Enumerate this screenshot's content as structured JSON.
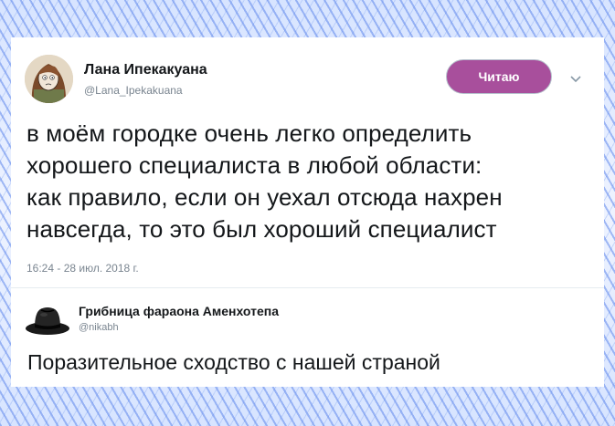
{
  "tweet": {
    "author_name": "Лана Ипекакуана",
    "author_handle": "@Lana_Ipekakuana",
    "follow_label": "Читаю",
    "text_lines": [
      "в моём городке очень легко определить",
      "хорошего специалиста в любой области:",
      "как правило, если он уехал отсюда нахрен",
      "навсегда, то это был хороший специалист"
    ],
    "timestamp": "16:24 - 28 июл. 2018 г."
  },
  "reply": {
    "author_name": "Грибница фараона Аменхотепа",
    "author_handle": "@nikabh",
    "text": "Поразительное сходство с нашей страной"
  },
  "icons": {
    "avatar": "cartoon-woman-avatar",
    "menu": "chevron-down-icon",
    "reply_avatar": "black-hat-avatar"
  },
  "colors": {
    "follow_button": "#a84f9c",
    "text": "#14171a",
    "muted": "#7a8590",
    "background_pattern": "#5f87eb"
  }
}
